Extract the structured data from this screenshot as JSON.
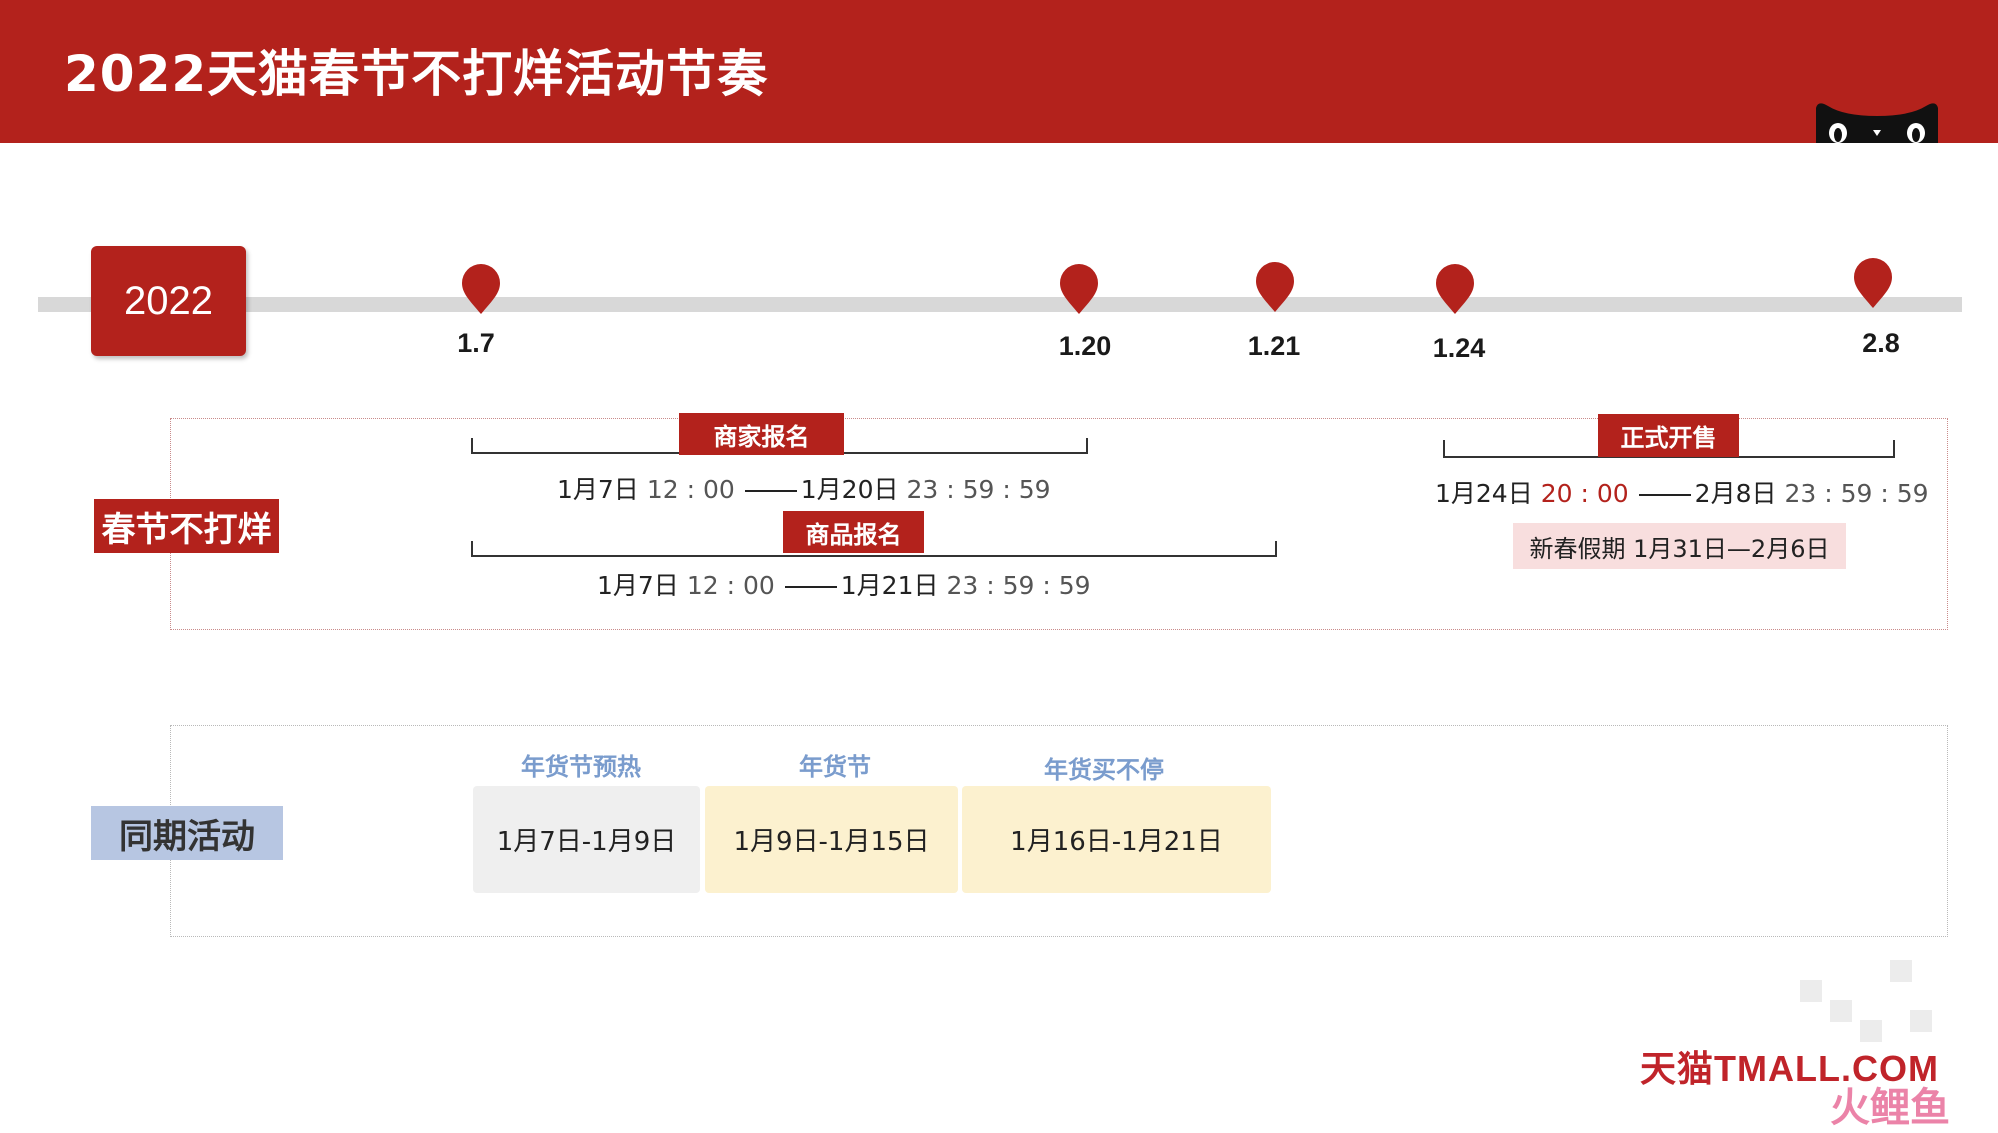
{
  "header": {
    "title": "2022天猫春节不打烊活动节奏"
  },
  "timeline": {
    "year": "2022",
    "dates": [
      {
        "label": "1.7"
      },
      {
        "label": "1.20"
      },
      {
        "label": "1.21"
      },
      {
        "label": "1.24"
      },
      {
        "label": "2.8"
      }
    ]
  },
  "spring_festival": {
    "label": "春节不打烊",
    "merchant_signup": {
      "tag": "商家报名",
      "start_date": "1月7日",
      "start_time": "12 : 00",
      "end_date": "1月20日",
      "end_time": "23 : 59 : 59"
    },
    "product_signup": {
      "tag": "商品报名",
      "start_date": "1月7日",
      "start_time": "12 : 00",
      "end_date": "1月21日",
      "end_time": "23 : 59 : 59"
    },
    "official_sale": {
      "tag": "正式开售",
      "start_date": "1月24日",
      "start_time": "20 : 00",
      "end_date": "2月8日",
      "end_time": "23 : 59 : 59"
    },
    "holiday_note": "新春假期 1月31日—2月6日"
  },
  "concurrent": {
    "label": "同期活动",
    "events": [
      {
        "title": "年货节预热",
        "period": "1月7日-1月9日",
        "color": "#efefef"
      },
      {
        "title": "年货节",
        "period": "1月9日-1月15日",
        "color": "#fcf1cf"
      },
      {
        "title": "年货买不停",
        "period": "1月16日-1月21日",
        "color": "#fcf1cf"
      }
    ]
  },
  "footer": {
    "logo_text": "天猫TMALL.COM",
    "watermark": "火鲤鱼"
  },
  "colors": {
    "brand_red": "#b3221c",
    "event_title_blue": "#7a9ccd",
    "label_blue": "#b7c6e2"
  }
}
